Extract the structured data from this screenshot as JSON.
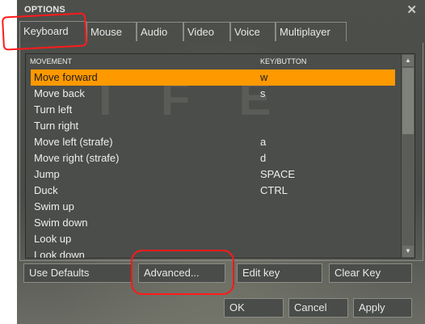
{
  "window": {
    "title": "OPTIONS",
    "close_glyph": "✕"
  },
  "tabs": [
    {
      "label": "Keyboard",
      "active": true
    },
    {
      "label": "Mouse"
    },
    {
      "label": "Audio"
    },
    {
      "label": "Video"
    },
    {
      "label": "Voice"
    },
    {
      "label": "Multiplayer"
    }
  ],
  "list": {
    "col_action": "MOVEMENT",
    "col_key": "KEY/BUTTON",
    "watermark": "IFE",
    "rows": [
      {
        "action": "Move forward",
        "key": "w",
        "selected": true
      },
      {
        "action": "Move back",
        "key": "s"
      },
      {
        "action": "Turn left",
        "key": ""
      },
      {
        "action": "Turn right",
        "key": ""
      },
      {
        "action": "Move left (strafe)",
        "key": "a"
      },
      {
        "action": "Move right (strafe)",
        "key": "d"
      },
      {
        "action": "Jump",
        "key": "SPACE"
      },
      {
        "action": "Duck",
        "key": "CTRL"
      },
      {
        "action": "Swim up",
        "key": ""
      },
      {
        "action": "Swim down",
        "key": ""
      },
      {
        "action": "Look up",
        "key": ""
      },
      {
        "action": "Look down",
        "key": ""
      }
    ]
  },
  "buttons": {
    "use_defaults": "Use Defaults",
    "advanced": "Advanced...",
    "edit_key": "Edit key",
    "clear_key": "Clear Key",
    "ok": "OK",
    "cancel": "Cancel",
    "apply": "Apply"
  },
  "colors": {
    "selection": "#ff9900",
    "annotation": "#ff1a1a"
  }
}
